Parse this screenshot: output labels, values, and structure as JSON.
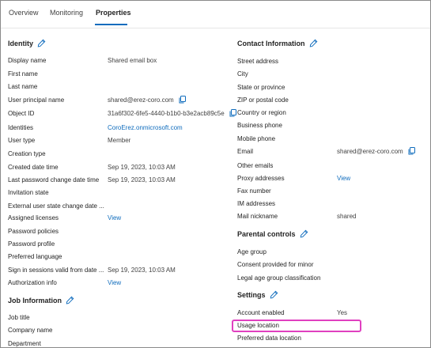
{
  "tabs": [
    {
      "label": "Overview"
    },
    {
      "label": "Monitoring"
    },
    {
      "label": "Properties"
    }
  ],
  "identity": {
    "title": "Identity",
    "rows": [
      {
        "label": "Display name",
        "value": "Shared email box"
      },
      {
        "label": "First name",
        "value": ""
      },
      {
        "label": "Last name",
        "value": ""
      },
      {
        "label": "User principal name",
        "value": "shared@erez-coro.com"
      },
      {
        "label": "Object ID",
        "value": "31a6f302-6fe5-4440-b1b0-b3e2acb89c5e"
      },
      {
        "label": "Identities",
        "value": "CoroErez.onmicrosoft.com"
      },
      {
        "label": "User type",
        "value": "Member"
      },
      {
        "label": "Creation type",
        "value": ""
      },
      {
        "label": "Created date time",
        "value": "Sep 19, 2023, 10:03 AM"
      },
      {
        "label": "Last password change date time",
        "value": "Sep 19, 2023, 10:03 AM"
      },
      {
        "label": "Invitation state",
        "value": ""
      },
      {
        "label": "External user state change date ...",
        "value": ""
      },
      {
        "label": "Assigned licenses",
        "value": "View"
      },
      {
        "label": "Password policies",
        "value": ""
      },
      {
        "label": "Password profile",
        "value": ""
      },
      {
        "label": "Preferred language",
        "value": ""
      },
      {
        "label": "Sign in sessions valid from date ...",
        "value": "Sep 19, 2023, 10:03 AM"
      },
      {
        "label": "Authorization info",
        "value": "View"
      }
    ]
  },
  "job": {
    "title": "Job Information",
    "rows": [
      {
        "label": "Job title"
      },
      {
        "label": "Company name"
      },
      {
        "label": "Department"
      }
    ]
  },
  "contact": {
    "title": "Contact Information",
    "rows": [
      {
        "label": "Street address",
        "value": ""
      },
      {
        "label": "City",
        "value": ""
      },
      {
        "label": "State or province",
        "value": ""
      },
      {
        "label": "ZIP or postal code",
        "value": ""
      },
      {
        "label": "Country or region",
        "value": ""
      },
      {
        "label": "Business phone",
        "value": ""
      },
      {
        "label": "Mobile phone",
        "value": ""
      },
      {
        "label": "Email",
        "value": "shared@erez-coro.com"
      },
      {
        "label": "Other emails",
        "value": ""
      },
      {
        "label": "Proxy addresses",
        "value": "View"
      },
      {
        "label": "Fax number",
        "value": ""
      },
      {
        "label": "IM addresses",
        "value": ""
      },
      {
        "label": "Mail nickname",
        "value": "shared"
      }
    ]
  },
  "parental": {
    "title": "Parental controls",
    "rows": [
      {
        "label": "Age group"
      },
      {
        "label": "Consent provided for minor"
      },
      {
        "label": "Legal age group classification"
      }
    ]
  },
  "settings": {
    "title": "Settings",
    "rows": [
      {
        "label": "Account enabled",
        "value": "Yes"
      },
      {
        "label": "Usage location",
        "value": ""
      },
      {
        "label": "Preferred data location",
        "value": ""
      }
    ]
  },
  "colors": {
    "accent": "#0f6cbd",
    "highlight": "#e040c0"
  }
}
